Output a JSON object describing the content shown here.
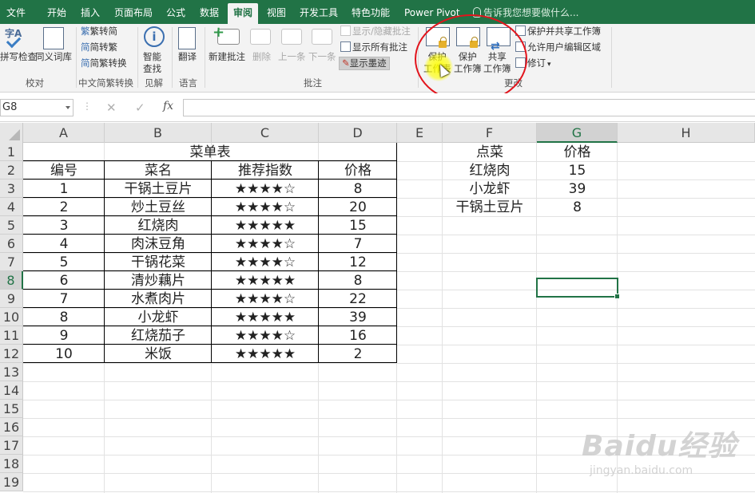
{
  "tabs": [
    "文件",
    "开始",
    "插入",
    "页面布局",
    "公式",
    "数据",
    "审阅",
    "视图",
    "开发工具",
    "特色功能",
    "Power Pivot"
  ],
  "active_tab": "审阅",
  "tell_me": "告诉我您想要做什么...",
  "ribbon": {
    "proofing": {
      "spelling": "拼写检查",
      "thesaurus": "同义词库",
      "group": "校对",
      "icon_glyph": "字A"
    },
    "chinese": {
      "to_simplified": "繁转简",
      "to_traditional": "简转繁",
      "convert": "简繁转换",
      "group": "中文简繁转换",
      "glyph_trad": "繁",
      "glyph_simp": "简",
      "glyph_conv": "简"
    },
    "insights": {
      "smart_lookup_1": "智能",
      "smart_lookup_2": "查找",
      "group": "见解"
    },
    "language": {
      "translate": "翻译",
      "group": "语言"
    },
    "comments": {
      "new": "新建批注",
      "delete": "删除",
      "previous": "上一条",
      "next": "下一条",
      "show_hide": "显示/隐藏批注",
      "show_all": "显示所有批注",
      "show_ink": "显示墨迹",
      "group": "批注"
    },
    "changes": {
      "protect_sheet_1": "保护",
      "protect_sheet_2": "工作表",
      "protect_wb_1": "保护",
      "protect_wb_2": "工作簿",
      "share_wb_1": "共享",
      "share_wb_2": "工作簿",
      "protect_share": "保护并共享工作簿",
      "allow_edit": "允许用户编辑区域",
      "track": "修订",
      "group": "更改"
    }
  },
  "formula_bar": {
    "name_box": "G8",
    "cancel": "✕",
    "enter": "✓",
    "fx": "fx",
    "dots": "⋮"
  },
  "columns": [
    "A",
    "B",
    "C",
    "D",
    "E",
    "F",
    "G",
    "H"
  ],
  "selected_column": "G",
  "rows": [
    "1",
    "2",
    "3",
    "4",
    "5",
    "6",
    "7",
    "8",
    "9",
    "10",
    "11",
    "12",
    "13",
    "14",
    "15",
    "16",
    "17",
    "18",
    "19"
  ],
  "selected_row": "8",
  "menu_table": {
    "title": "菜单表",
    "headers": [
      "编号",
      "菜名",
      "推荐指数",
      "价格"
    ],
    "rows": [
      [
        "1",
        "干锅土豆片",
        "★★★★☆",
        "8"
      ],
      [
        "2",
        "炒土豆丝",
        "★★★★☆",
        "20"
      ],
      [
        "3",
        "红烧肉",
        "★★★★★",
        "15"
      ],
      [
        "4",
        "肉沫豆角",
        "★★★★☆",
        "7"
      ],
      [
        "5",
        "干锅花菜",
        "★★★★☆",
        "12"
      ],
      [
        "6",
        "清炒藕片",
        "★★★★★",
        "8"
      ],
      [
        "7",
        "水煮肉片",
        "★★★★☆",
        "22"
      ],
      [
        "8",
        "小龙虾",
        "★★★★★",
        "39"
      ],
      [
        "9",
        "红烧茄子",
        "★★★★☆",
        "16"
      ],
      [
        "10",
        "米饭",
        "★★★★★",
        "2"
      ]
    ]
  },
  "order_table": {
    "headers": [
      "点菜",
      "价格"
    ],
    "rows": [
      [
        "红烧肉",
        "15"
      ],
      [
        "小龙虾",
        "39"
      ],
      [
        "干锅土豆片",
        "8"
      ]
    ]
  },
  "watermark": {
    "brand": "Baidu经验",
    "url": "jingyan.baidu.com"
  },
  "colors": {
    "excel_green": "#217346",
    "annotation_red": "#e2141c",
    "cursor_highlight": "#ffff00"
  }
}
